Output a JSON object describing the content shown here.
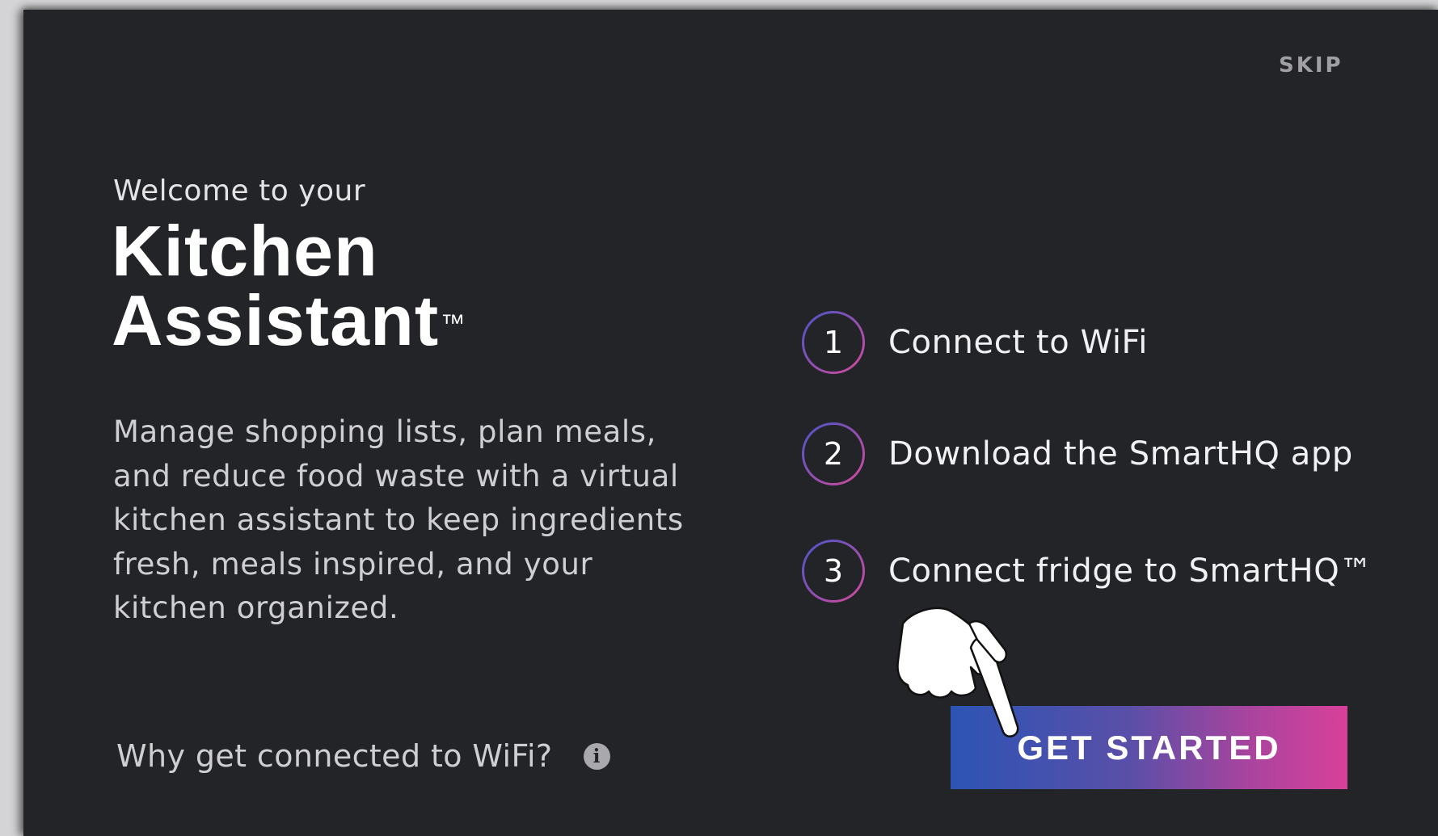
{
  "skip_label": "SKIP",
  "welcome": {
    "subtitle": "Welcome to your",
    "title_line1": "Kitchen",
    "title_line2": "Assistant",
    "trademark": "™"
  },
  "description": "Manage shopping lists, plan meals, and reduce food waste with a virtual kitchen assistant to keep ingredients fresh, meals inspired, and your kitchen organized.",
  "why_link": {
    "label": "Why get connected to WiFi?",
    "icon": "info-icon"
  },
  "steps": [
    {
      "number": "1",
      "label": "Connect to WiFi"
    },
    {
      "number": "2",
      "label": "Download the SmartHQ app"
    },
    {
      "number": "3",
      "label": "Connect fridge to SmartHQ™"
    }
  ],
  "get_started_label": "GET STARTED",
  "colors": {
    "background": "#232428",
    "button_gradient_start": "#2c54b4",
    "button_gradient_end": "#d9409a",
    "step_ring_start": "#4a55c8",
    "step_ring_end": "#d44a9c"
  },
  "pointer_icon": "hand-pointer-icon"
}
